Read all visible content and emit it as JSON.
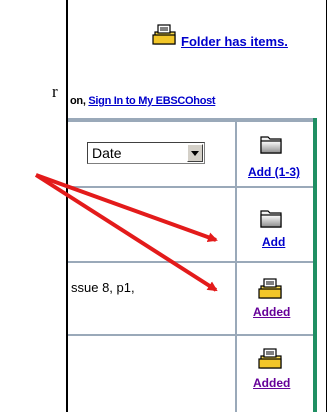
{
  "left_fragment": {
    "text": "r"
  },
  "header": {
    "folder_link": "Folder has items.",
    "sign_in_prefix": "on, ",
    "sign_in_link": "Sign In to My EBSCOhost"
  },
  "sort": {
    "selected": "Date"
  },
  "actions": {
    "add_range": "Add (1-3)",
    "add": "Add",
    "added_1": "Added",
    "added_2": "Added"
  },
  "result": {
    "fragment": "ssue 8, p1,"
  },
  "colors": {
    "arrow": "#e31b1b",
    "link": "#0000cc",
    "visited": "#660099",
    "green_border": "#1f8f63"
  }
}
